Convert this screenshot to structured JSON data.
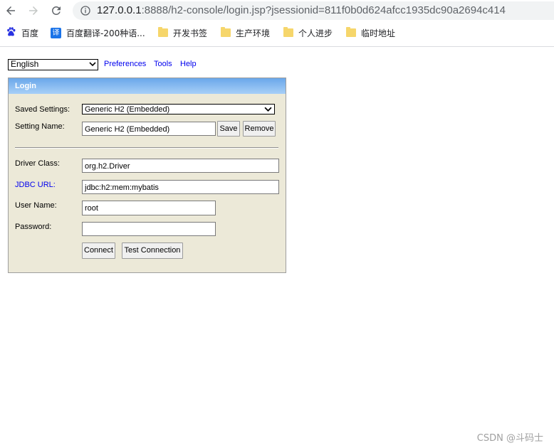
{
  "browser": {
    "url_host": "127.0.0.1",
    "url_rest": ":8888/h2-console/login.jsp?jsessionid=811f0b0d624afcc1935dc90a2694c414",
    "bookmarks": [
      {
        "label": "百度",
        "icon": "baidu-paw-icon"
      },
      {
        "label": "百度翻译-200种语...",
        "icon": "translate-icon"
      },
      {
        "label": "开发书签",
        "icon": "folder-icon"
      },
      {
        "label": "生产环境",
        "icon": "folder-icon"
      },
      {
        "label": "个人进步",
        "icon": "folder-icon"
      },
      {
        "label": "临时地址",
        "icon": "folder-icon"
      }
    ],
    "translate_glyph": "译"
  },
  "toolbar": {
    "language": "English",
    "preferences": "Preferences",
    "tools": "Tools",
    "help": "Help"
  },
  "login": {
    "title": "Login",
    "saved_settings_label": "Saved Settings:",
    "saved_settings_value": "Generic H2 (Embedded)",
    "setting_name_label": "Setting Name:",
    "setting_name_value": "Generic H2 (Embedded)",
    "save_button": "Save",
    "remove_button": "Remove",
    "driver_class_label": "Driver Class:",
    "driver_class_value": "org.h2.Driver",
    "jdbc_url_label": "JDBC URL:",
    "jdbc_url_value": "jdbc:h2:mem:mybatis",
    "user_name_label": "User Name:",
    "user_name_value": "root",
    "password_label": "Password:",
    "password_value": "",
    "connect_button": "Connect",
    "test_connection_button": "Test Connection"
  },
  "watermark": "CSDN @斗码士",
  "colors": {
    "panel_bg": "#ece9d8",
    "header_gradient_top": "#6aa7ea",
    "header_gradient_bottom": "#a7cff7",
    "link": "#0000ee",
    "folder": "#f6d66b"
  }
}
